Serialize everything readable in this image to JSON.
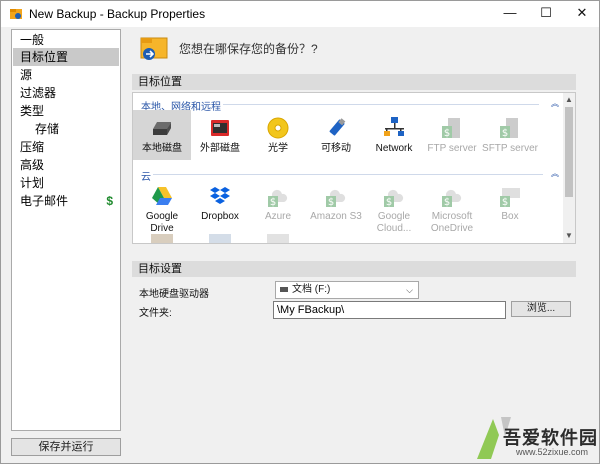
{
  "window": {
    "title": "New Backup - Backup Properties",
    "minimize_glyph": "—",
    "maximize_glyph": "☐",
    "close_glyph": "✕"
  },
  "sidebar": {
    "items": [
      {
        "label": "一般",
        "selected": false,
        "sub": false
      },
      {
        "label": "目标位置",
        "selected": true,
        "sub": false
      },
      {
        "label": "源",
        "selected": false,
        "sub": false
      },
      {
        "label": "过滤器",
        "selected": false,
        "sub": false
      },
      {
        "label": "类型",
        "selected": false,
        "sub": false
      },
      {
        "label": "存储",
        "selected": false,
        "sub": true
      },
      {
        "label": "压缩",
        "selected": false,
        "sub": false
      },
      {
        "label": "高级",
        "selected": false,
        "sub": false
      },
      {
        "label": "计划",
        "selected": false,
        "sub": false
      },
      {
        "label": "电子邮件",
        "selected": false,
        "sub": false,
        "badge": "$"
      }
    ],
    "run_button": "保存并运行"
  },
  "main": {
    "question": "您想在哪保存您的备份？?",
    "destination_header": "目标位置",
    "local_section": "本地、网络和远程",
    "cloud_section": "云",
    "local_tiles": [
      {
        "label": "本地磁盘",
        "icon": "hard-disk-icon",
        "selected": true,
        "disabled": false
      },
      {
        "label": "外部磁盘",
        "icon": "external-disk-icon",
        "selected": false,
        "disabled": false
      },
      {
        "label": "光学",
        "icon": "optical-disc-icon",
        "selected": false,
        "disabled": false
      },
      {
        "label": "可移动",
        "icon": "usb-drive-icon",
        "selected": false,
        "disabled": false
      },
      {
        "label": "Network",
        "icon": "network-icon",
        "selected": false,
        "disabled": false
      },
      {
        "label": "FTP server",
        "icon": "ftp-server-icon",
        "selected": false,
        "disabled": true
      },
      {
        "label": "SFTP server",
        "icon": "sftp-server-icon",
        "selected": false,
        "disabled": true
      }
    ],
    "cloud_tiles": [
      {
        "label": "Google Drive",
        "icon": "google-drive-icon",
        "disabled": false
      },
      {
        "label": "Dropbox",
        "icon": "dropbox-icon",
        "disabled": false
      },
      {
        "label": "Azure",
        "icon": "azure-icon",
        "disabled": true
      },
      {
        "label": "Amazon S3",
        "icon": "amazon-s3-icon",
        "disabled": true
      },
      {
        "label": "Google Cloud...",
        "icon": "google-cloud-icon",
        "disabled": true
      },
      {
        "label": "Microsoft OneDrive",
        "icon": "onedrive-icon",
        "disabled": true
      },
      {
        "label": "Box",
        "icon": "box-icon",
        "disabled": true
      }
    ],
    "settings_header": "目标设置",
    "drive_label": "本地硬盘驱动器",
    "drive_value": "文档 (F:)",
    "folder_label": "文件夹:",
    "folder_value": "\\My FBackup\\",
    "browse_button": "浏览..."
  },
  "watermark": {
    "text": "吾爱软件园",
    "url": "www.52zixue.com"
  },
  "colors": {
    "selected_bg": "#c9c9c9",
    "section_blue": "#2a56a8",
    "dollar_green": "#1f8a2d",
    "paid_badge_green": "#2e8b3e"
  }
}
